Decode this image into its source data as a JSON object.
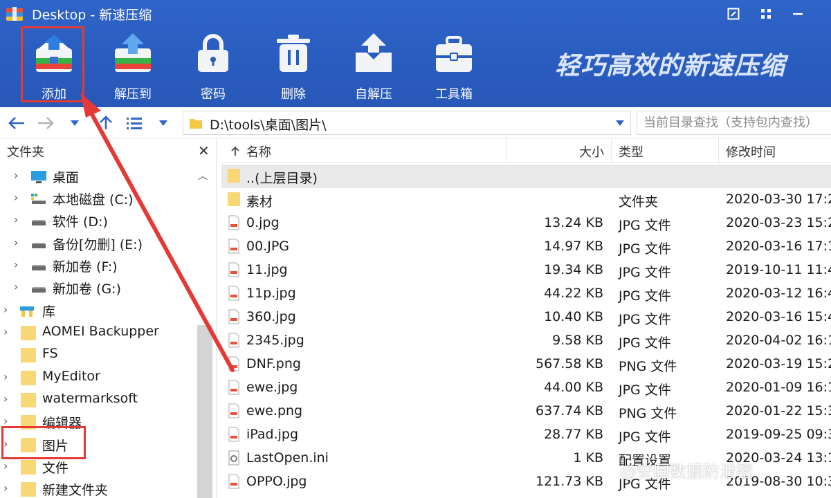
{
  "window": {
    "title": "Desktop - 新速压缩"
  },
  "toolbar": {
    "items": [
      {
        "label": "添加",
        "icon": "add-archive-icon"
      },
      {
        "label": "解压到",
        "icon": "extract-to-icon"
      },
      {
        "label": "密码",
        "icon": "lock-icon"
      },
      {
        "label": "删除",
        "icon": "trash-icon"
      },
      {
        "label": "自解压",
        "icon": "self-extract-icon"
      },
      {
        "label": "工具箱",
        "icon": "toolbox-icon"
      }
    ],
    "slogan": "轻巧高效的新速压缩"
  },
  "address": {
    "path": "D:\\tools\\桌面\\图片\\",
    "search_placeholder": "当前目录查找（支持包内查找）"
  },
  "tree": {
    "header": "文件夹",
    "items": [
      {
        "label": "桌面",
        "icon": "desktop-icon"
      },
      {
        "label": "本地磁盘 (C:)",
        "icon": "system-drive-icon"
      },
      {
        "label": "软件 (D:)",
        "icon": "drive-icon"
      },
      {
        "label": "备份[勿删] (E:)",
        "icon": "drive-icon"
      },
      {
        "label": "新加卷 (F:)",
        "icon": "drive-icon"
      },
      {
        "label": "新加卷 (G:)",
        "icon": "drive-icon"
      },
      {
        "label": "库",
        "icon": "library-icon"
      },
      {
        "label": "AOMEI Backupper",
        "icon": "folder-icon"
      },
      {
        "label": "FS",
        "icon": "folder-icon"
      },
      {
        "label": "MyEditor",
        "icon": "folder-icon"
      },
      {
        "label": "watermarksoft",
        "icon": "folder-icon"
      },
      {
        "label": "编辑器",
        "icon": "folder-icon"
      },
      {
        "label": "图片",
        "icon": "folder-icon"
      },
      {
        "label": "文件",
        "icon": "folder-icon"
      },
      {
        "label": "新建文件夹",
        "icon": "folder-icon"
      }
    ]
  },
  "list": {
    "columns": {
      "name": "名称",
      "size": "大小",
      "type": "类型",
      "modified": "修改时间"
    },
    "rows": [
      {
        "name": "..(上层目录)",
        "size": "",
        "type": "",
        "modified": "",
        "icon": "folder-icon"
      },
      {
        "name": "素材",
        "size": "",
        "type": "文件夹",
        "modified": "2020-03-30 17:2",
        "icon": "folder-icon"
      },
      {
        "name": "0.jpg",
        "size": "13.24 KB",
        "type": "JPG 文件",
        "modified": "2020-03-23 15:2",
        "icon": "image-file-icon"
      },
      {
        "name": "00.JPG",
        "size": "14.97 KB",
        "type": "JPG 文件",
        "modified": "2020-03-16 17:1",
        "icon": "image-file-icon"
      },
      {
        "name": "11.jpg",
        "size": "19.34 KB",
        "type": "JPG 文件",
        "modified": "2019-10-11 11:4",
        "icon": "image-file-icon"
      },
      {
        "name": "11p.jpg",
        "size": "44.22 KB",
        "type": "JPG 文件",
        "modified": "2020-03-12 16:4",
        "icon": "image-file-icon"
      },
      {
        "name": "360.jpg",
        "size": "10.40 KB",
        "type": "JPG 文件",
        "modified": "2020-03-16 15:4",
        "icon": "image-file-icon"
      },
      {
        "name": "2345.jpg",
        "size": "9.58 KB",
        "type": "JPG 文件",
        "modified": "2020-04-02 16:1",
        "icon": "image-file-icon"
      },
      {
        "name": "DNF.png",
        "size": "567.58 KB",
        "type": "PNG 文件",
        "modified": "2020-03-19 15:2",
        "icon": "image-file-icon"
      },
      {
        "name": "ewe.jpg",
        "size": "44.00 KB",
        "type": "JPG 文件",
        "modified": "2020-01-09 16:1",
        "icon": "image-file-icon"
      },
      {
        "name": "ewe.png",
        "size": "637.74 KB",
        "type": "PNG 文件",
        "modified": "2020-01-22 15:3",
        "icon": "image-file-icon"
      },
      {
        "name": "iPad.jpg",
        "size": "28.77 KB",
        "type": "JPG 文件",
        "modified": "2019-09-25 09:3",
        "icon": "image-file-icon"
      },
      {
        "name": "LastOpen.ini",
        "size": "1 KB",
        "type": "配置设置",
        "modified": "2020-03-24 13:1",
        "icon": "settings-file-icon"
      },
      {
        "name": "OPPO.jpg",
        "size": "121.73 KB",
        "type": "JPG 文件",
        "modified": "2019-08-30 10:3",
        "icon": "image-file-icon"
      }
    ]
  },
  "watermark": "@安固数据防泄密",
  "colors": {
    "ribbon": "#2a5cbf",
    "highlight": "#e53935",
    "folder": "#f5c842",
    "parent_row": "#e9e9e9"
  }
}
